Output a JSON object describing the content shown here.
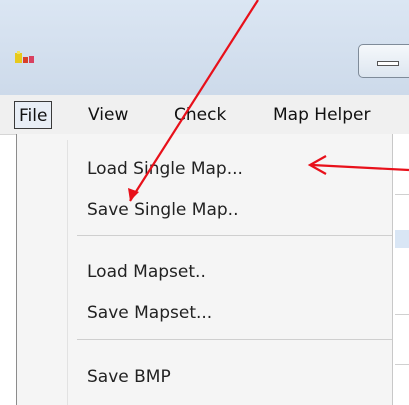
{
  "menubar": {
    "items": [
      {
        "label": "File",
        "active": true
      },
      {
        "label": "View"
      },
      {
        "label": "Check"
      },
      {
        "label": "Map Helper"
      }
    ]
  },
  "file_menu": {
    "items": [
      {
        "label": "Load Single Map..."
      },
      {
        "label": "Save Single Map.."
      },
      {
        "label": "Load Mapset.."
      },
      {
        "label": "Save Mapset..."
      },
      {
        "label": "Save BMP"
      }
    ]
  },
  "annotation": {
    "arrow_color": "#e8101a"
  }
}
